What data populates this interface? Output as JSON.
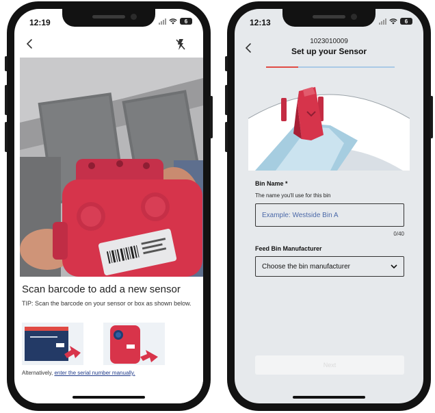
{
  "left_screen": {
    "status": {
      "time": "12:19",
      "battery": "6"
    },
    "icons": {
      "back": "chevron-left-icon",
      "flash": "flash-off-icon"
    },
    "scan": {
      "title": "Scan barcode to add a new sensor",
      "tip": "TIP: Scan the barcode on your sensor or box as shown below.",
      "alt_prefix": "Alternatively,",
      "alt_link": "enter the serial number manually."
    }
  },
  "right_screen": {
    "status": {
      "time": "12:13",
      "battery": "6"
    },
    "icons": {
      "back": "chevron-left-icon",
      "dropdown": "chevron-down-icon"
    },
    "header": {
      "serial": "1023010009",
      "title": "Set up your Sensor"
    },
    "progress": {
      "fraction": 0.25,
      "fill_color": "#e04a44",
      "track_color": "#a9c9e6"
    },
    "form": {
      "bin_name_label": "Bin Name *",
      "bin_name_help": "The name you'll use for this bin",
      "bin_name_placeholder": "Example: Westside Bin A",
      "char_count": "0/40",
      "manufacturer_label": "Feed Bin Manufacturer",
      "manufacturer_selected": "Choose the bin manufacturer"
    },
    "next_label": "Next"
  },
  "colors": {
    "sensor_red": "#d8344a",
    "link_blue": "#1f3a8a",
    "placeholder_blue": "#4a68a8"
  }
}
